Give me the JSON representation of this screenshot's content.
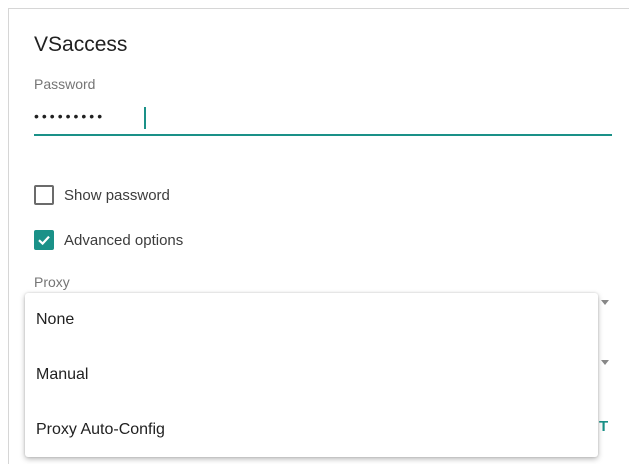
{
  "dialog": {
    "title": "VSaccess",
    "password_label": "Password",
    "password_value": "•••••••••"
  },
  "options": {
    "show_password": {
      "label": "Show password",
      "checked": false
    },
    "advanced_options": {
      "label": "Advanced options",
      "checked": true
    }
  },
  "proxy": {
    "label": "Proxy",
    "menu_items": [
      "None",
      "Manual",
      "Proxy Auto-Config"
    ]
  },
  "right_edge_text": "T",
  "colors": {
    "accent": "#1a9188",
    "text": "#212121",
    "secondary_text": "#757575"
  }
}
